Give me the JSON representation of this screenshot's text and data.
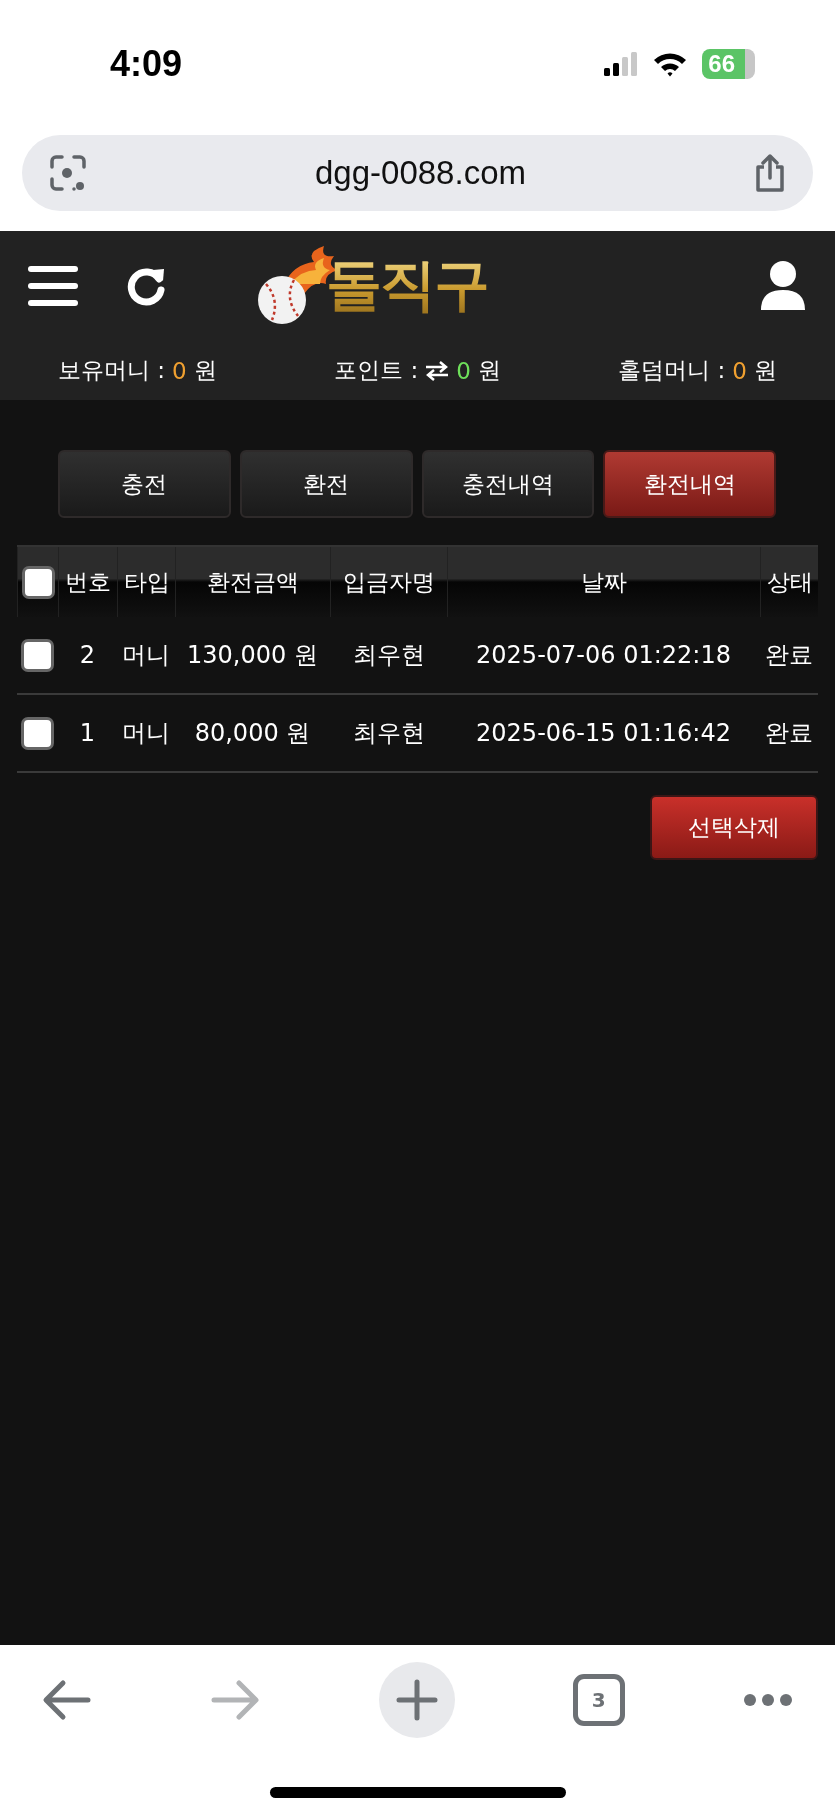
{
  "status_bar": {
    "time": "4:09",
    "battery": "66"
  },
  "browser": {
    "url": "dgg-0088.com",
    "tab_count": "3"
  },
  "header": {
    "logo": "돌직구"
  },
  "balances": [
    {
      "label": "보유머니 :",
      "value": "0",
      "unit": "원",
      "color": "#f0a030",
      "kind": "plain"
    },
    {
      "label": "포인트 :",
      "value": "0",
      "unit": "원",
      "color": "#6ee05a",
      "kind": "exchange"
    },
    {
      "label": "홀덤머니 :",
      "value": "0",
      "unit": "원",
      "color": "#f0a030",
      "kind": "plain"
    }
  ],
  "tabs": [
    {
      "label": "충전",
      "selected": false
    },
    {
      "label": "환전",
      "selected": false
    },
    {
      "label": "충전내역",
      "selected": false
    },
    {
      "label": "환전내역",
      "selected": true
    }
  ],
  "table": {
    "select_all": {
      "checked": false
    },
    "columns": [
      "번호",
      "타입",
      "환전금액",
      "입금자명",
      "날짜",
      "상태"
    ],
    "rows": [
      {
        "checked": false,
        "cells": [
          "2",
          "머니",
          "130,000 원",
          "최우현",
          "2025-07-06 01:22:18",
          "완료"
        ]
      },
      {
        "checked": false,
        "cells": [
          "1",
          "머니",
          "80,000 원",
          "최우현",
          "2025-06-15 01:16:42",
          "완료"
        ]
      }
    ]
  },
  "delete_button": "선택삭제"
}
